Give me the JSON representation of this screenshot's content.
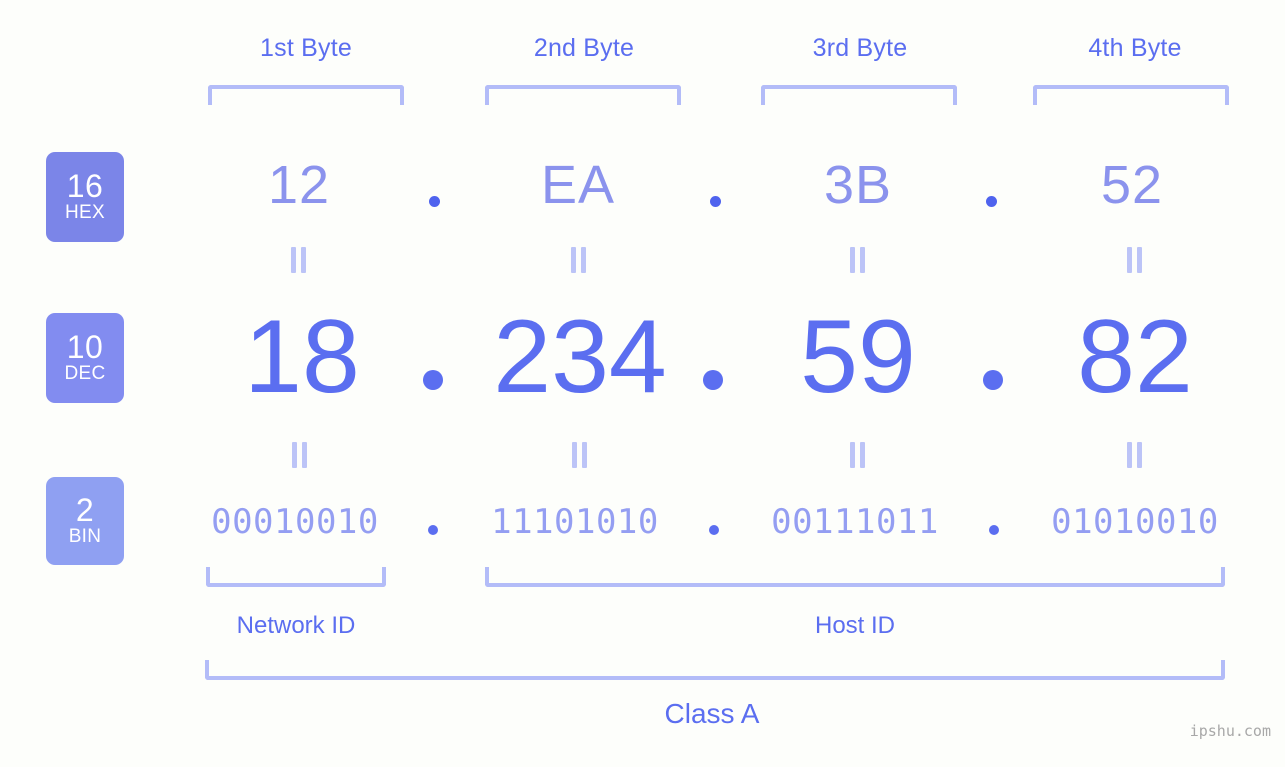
{
  "background_color": "#fdfefb",
  "accent_colors": {
    "primary_blue": "#5b6ef0",
    "light_blue": "#8b93ed",
    "bracket_blue": "#b3bcf8",
    "badge_hex": "#7b85e8",
    "badge_dec": "#828cf0",
    "badge_bin": "#8fa0f2",
    "watermark_gray": "#a8a8a8"
  },
  "byte_headers": [
    {
      "label": "1st Byte"
    },
    {
      "label": "2nd Byte"
    },
    {
      "label": "3rd Byte"
    },
    {
      "label": "4th Byte"
    }
  ],
  "bases": [
    {
      "num": "16",
      "name": "HEX"
    },
    {
      "num": "10",
      "name": "DEC"
    },
    {
      "num": "2",
      "name": "BIN"
    }
  ],
  "rows": {
    "hex": {
      "base_num": "16",
      "base_name": "HEX",
      "values": [
        "12",
        "EA",
        "3B",
        "52"
      ],
      "separator": "."
    },
    "dec": {
      "base_num": "10",
      "base_name": "DEC",
      "values": [
        "18",
        "234",
        "59",
        "82"
      ],
      "separator": "."
    },
    "bin": {
      "base_num": "2",
      "base_name": "BIN",
      "values": [
        "00010010",
        "11101010",
        "00111011",
        "01010010"
      ],
      "separator": "."
    }
  },
  "equality_symbol": "=",
  "partitions": {
    "network_id": "Network ID",
    "host_id": "Host ID"
  },
  "class_label": "Class A",
  "watermark": "ipshu.com"
}
